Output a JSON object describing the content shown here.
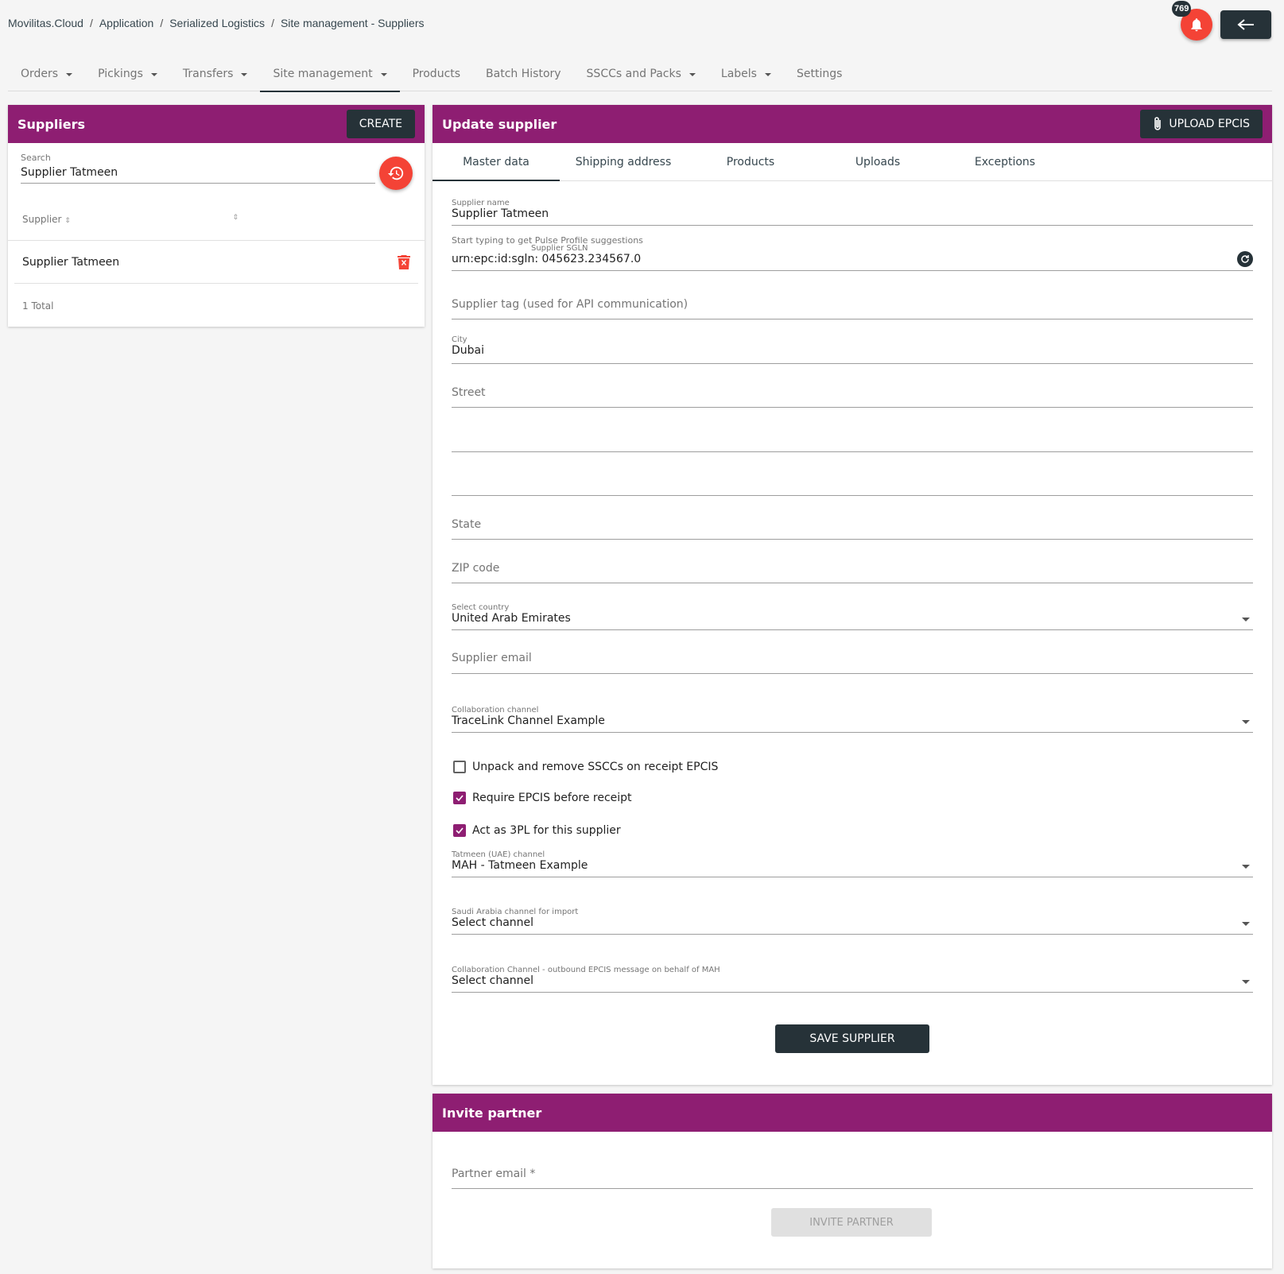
{
  "breadcrumb": [
    "Movilitas.Cloud",
    "Application",
    "Serialized Logistics",
    "Site management - Suppliers"
  ],
  "notifications": {
    "count": "769",
    "icon": "bell-icon"
  },
  "back_icon": "arrow-left-icon",
  "nav": [
    {
      "label": "Orders",
      "dropdown": true
    },
    {
      "label": "Pickings",
      "dropdown": true
    },
    {
      "label": "Transfers",
      "dropdown": true
    },
    {
      "label": "Site management",
      "dropdown": true,
      "active": true
    },
    {
      "label": "Products",
      "dropdown": false
    },
    {
      "label": "Batch History",
      "dropdown": false
    },
    {
      "label": "SSCCs and Packs",
      "dropdown": true
    },
    {
      "label": "Labels",
      "dropdown": true
    },
    {
      "label": "Settings",
      "dropdown": false
    }
  ],
  "suppliers_panel": {
    "title": "Suppliers",
    "create_label": "CREATE",
    "search_label": "Search",
    "search_value": "Supplier Tatmeen",
    "column_header": "Supplier",
    "rows": [
      "Supplier Tatmeen"
    ],
    "total": "1 Total"
  },
  "update_panel": {
    "title": "Update supplier",
    "upload_label": "UPLOAD EPCIS",
    "tabs": [
      "Master data",
      "Shipping address",
      "Products",
      "Uploads",
      "Exceptions"
    ],
    "supplier_name_label": "Supplier name",
    "supplier_name_value": "Supplier Tatmeen",
    "hint": "Start typing to get Pulse Profile suggestions",
    "sgln_label": "Supplier SGLN",
    "sgln_value": "urn:epc:id:sgln: 045623.234567.0",
    "tag_placeholder": "Supplier tag (used for API communication)",
    "city_label": "City",
    "city_value": "Dubai",
    "street_placeholder": "Street",
    "state_placeholder": "State",
    "zip_placeholder": "ZIP code",
    "country_label": "Select country",
    "country_value": "United Arab Emirates",
    "email_placeholder": "Supplier email",
    "collab_label": "Collaboration channel",
    "collab_value": "TraceLink Channel Example",
    "checkboxes": [
      {
        "label": "Unpack and remove SSCCs on receipt EPCIS",
        "checked": false
      },
      {
        "label": "Require EPCIS before receipt",
        "checked": true
      },
      {
        "label": "Act as 3PL for this supplier",
        "checked": true
      }
    ],
    "tatmeen_label": "Tatmeen (UAE) channel",
    "tatmeen_value": "MAH - Tatmeen Example",
    "saudi_label": "Saudi Arabia channel for import",
    "saudi_value": "Select channel",
    "outbound_label": "Collaboration Channel - outbound EPCIS message on behalf of MAH",
    "outbound_value": "Select channel",
    "save_label": "SAVE SUPPLIER"
  },
  "invite_panel": {
    "title": "Invite partner",
    "email_placeholder": "Partner email *",
    "invite_label": "INVITE PARTNER"
  },
  "colors": {
    "header": "#8e1e72",
    "dark": "#263238",
    "accent": "#f44336"
  }
}
